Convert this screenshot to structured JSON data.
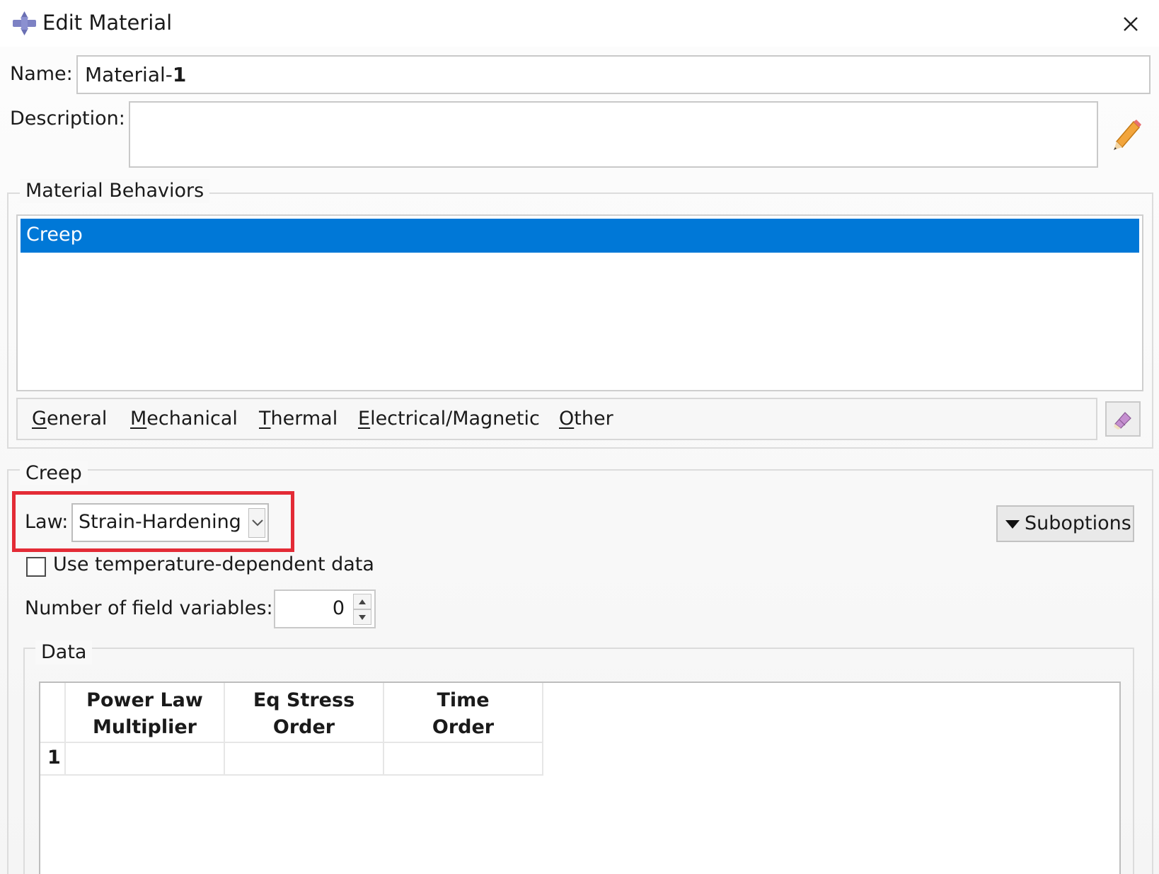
{
  "window": {
    "title": "Edit Material",
    "close_icon": "close-icon",
    "app_icon": "abaqus-logo-icon"
  },
  "fields": {
    "name_label": "Name:",
    "name_value_prefix": "Material-",
    "name_value_suffix": "1",
    "description_label": "Description:",
    "description_value": "",
    "edit_icon": "pencil-icon"
  },
  "behaviors": {
    "group_label": "Material Behaviors",
    "items": [
      {
        "label": "Creep",
        "selected": true
      }
    ],
    "delete_icon": "eraser-icon"
  },
  "menu": {
    "items": [
      {
        "rest": "eneral",
        "mnemonic": "G"
      },
      {
        "rest": "echanical",
        "mnemonic": "M"
      },
      {
        "rest": "hermal",
        "mnemonic": "T"
      },
      {
        "rest": "lectrical/Magnetic",
        "mnemonic": "E"
      },
      {
        "rest": "ther",
        "mnemonic": "O"
      }
    ]
  },
  "creep": {
    "group_label": "Creep",
    "law_label": "Law:",
    "law_value": "Strain-Hardening",
    "suboptions_label": "Suboptions",
    "temp_dependent_label": "Use temperature-dependent data",
    "temp_dependent_checked": false,
    "field_vars_label": "Number of field variables:",
    "field_vars_value": "0"
  },
  "data": {
    "group_label": "Data",
    "columns": [
      {
        "line1": "Power Law",
        "line2": "Multiplier"
      },
      {
        "line1": "Eq Stress",
        "line2": "Order"
      },
      {
        "line1": "Time",
        "line2": "Order"
      }
    ],
    "rows": [
      {
        "index": "1",
        "values": [
          "",
          "",
          ""
        ]
      }
    ]
  },
  "colors": {
    "selection": "#0078d7",
    "highlight_border": "#e32b36"
  }
}
